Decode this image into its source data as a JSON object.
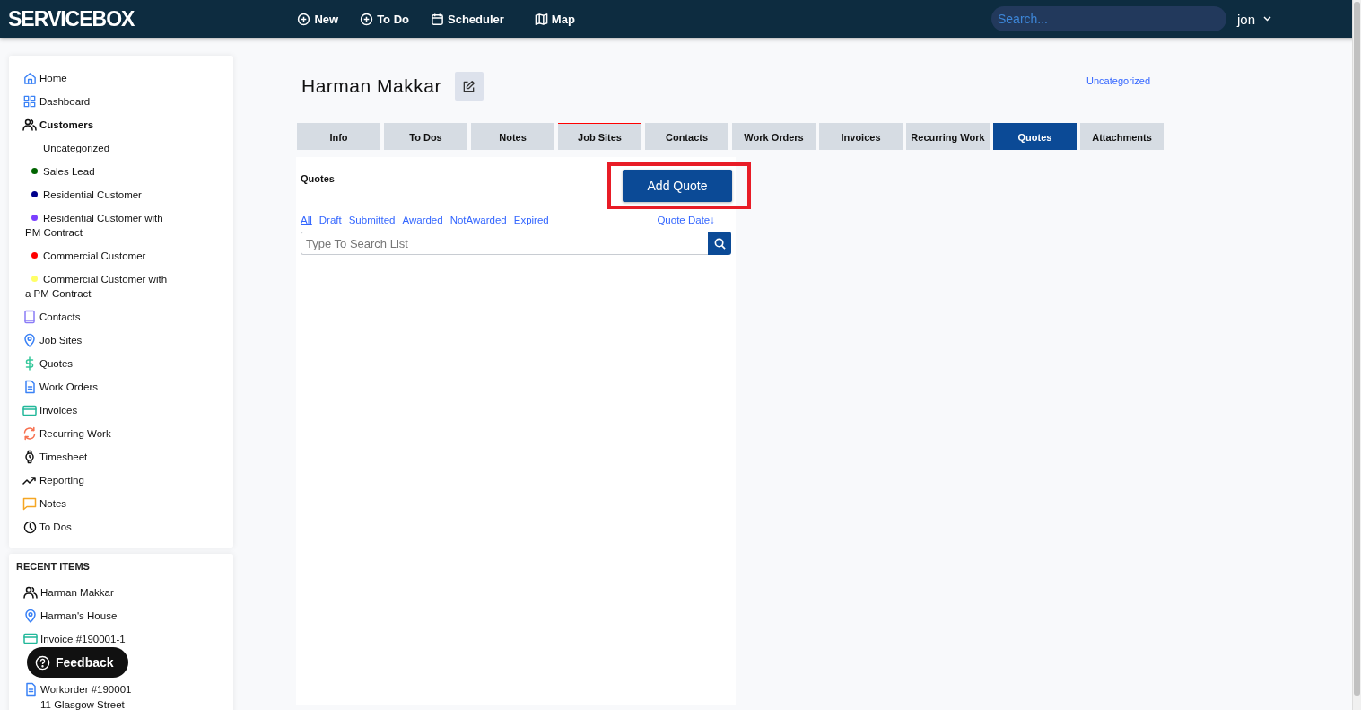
{
  "topbar": {
    "logo": "SERVICEBOX",
    "nav": [
      {
        "label": "New"
      },
      {
        "label": "To Do"
      },
      {
        "label": "Scheduler"
      },
      {
        "label": "Map"
      }
    ],
    "search": {
      "placeholder": "Search..."
    },
    "user": "jon"
  },
  "sidebar": {
    "items": [
      {
        "label": "Home",
        "selected": false
      },
      {
        "label": "Dashboard",
        "selected": false
      },
      {
        "label": "Customers",
        "selected": true,
        "expanded": true,
        "children": [
          {
            "label": "Uncategorized"
          },
          {
            "label": "Sales Lead",
            "color": "#006400"
          },
          {
            "label": "Residential Customer",
            "color": "#00008b"
          },
          {
            "label": "Residential Customer with PM Contract",
            "color": "#7b3fff"
          },
          {
            "label": "Commercial Customer",
            "color": "#ff0000"
          },
          {
            "label": "Commercial Customer with a PM Contract",
            "color": "#ffff66"
          }
        ]
      },
      {
        "label": "Contacts",
        "selected": false
      },
      {
        "label": "Job Sites",
        "selected": false
      },
      {
        "label": "Quotes",
        "selected": false
      },
      {
        "label": "Work Orders",
        "selected": false
      },
      {
        "label": "Invoices",
        "selected": false
      },
      {
        "label": "Recurring Work",
        "selected": false
      },
      {
        "label": "Timesheet",
        "selected": false
      },
      {
        "label": "Reporting",
        "selected": false
      },
      {
        "label": "Notes",
        "selected": false
      },
      {
        "label": "To Dos",
        "selected": false
      }
    ]
  },
  "recent_items": {
    "title": "RECENT ITEMS",
    "items": [
      {
        "label": "Harman Makkar"
      },
      {
        "label": "Harman's House"
      },
      {
        "label": "Invoice #190001-1"
      },
      {
        "label": "Workorder #190001",
        "sublabel": "11 Glasgow Street"
      }
    ]
  },
  "feedback_button": "Feedback",
  "customer": {
    "name": "Harman Makkar",
    "category": "Uncategorized"
  },
  "tabs": [
    {
      "label": "Info",
      "selected": false,
      "accent": false
    },
    {
      "label": "To Dos",
      "selected": false,
      "accent": false
    },
    {
      "label": "Notes",
      "selected": false,
      "accent": false
    },
    {
      "label": "Job Sites",
      "selected": false,
      "accent": true
    },
    {
      "label": "Contacts",
      "selected": false,
      "accent": false
    },
    {
      "label": "Work Orders",
      "selected": false,
      "accent": false
    },
    {
      "label": "Invoices",
      "selected": false,
      "accent": false
    },
    {
      "label": "Recurring Work",
      "selected": false,
      "accent": false
    },
    {
      "label": "Quotes",
      "selected": true,
      "accent": false
    },
    {
      "label": "Attachments",
      "selected": false,
      "accent": false
    }
  ],
  "quotes_panel": {
    "title": "Quotes",
    "add_button": {
      "label": "Add Quote",
      "highlighted": true
    },
    "filters": [
      {
        "label": "All",
        "selected": true
      },
      {
        "label": "Draft",
        "selected": false
      },
      {
        "label": "Submitted",
        "selected": false
      },
      {
        "label": "Awarded",
        "selected": false
      },
      {
        "label": "NotAwarded",
        "selected": false
      },
      {
        "label": "Expired",
        "selected": false
      }
    ],
    "sort": "Quote Date↓",
    "search": {
      "placeholder": "Type To Search List"
    }
  }
}
